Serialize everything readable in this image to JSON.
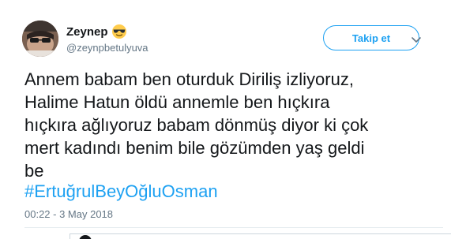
{
  "user": {
    "display_name": "Zeynep",
    "handle": "@zeynpbetulyuva",
    "name_emoji_icon": "sunglasses-emoji-icon",
    "avatar_icon": "profile-photo"
  },
  "header": {
    "follow_label": "Takip et",
    "menu_icon": "chevron-down-icon"
  },
  "tweet": {
    "text": "Annem babam ben oturduk Diriliş izliyoruz,\nHalime Hatun öldü annemle ben hıçkıra\nhıçkıra ağlıyoruz babam dönmüş diyor ki çok\nmert kadındı benim bile gözümden yaş geldi\nbe",
    "hashtag": "#ErtuğrulBeyOğluOsman",
    "timestamp": "00:22 - 3 May 2018"
  },
  "colors": {
    "accent": "#1da1f2",
    "text": "#14171a",
    "secondary": "#657786"
  }
}
